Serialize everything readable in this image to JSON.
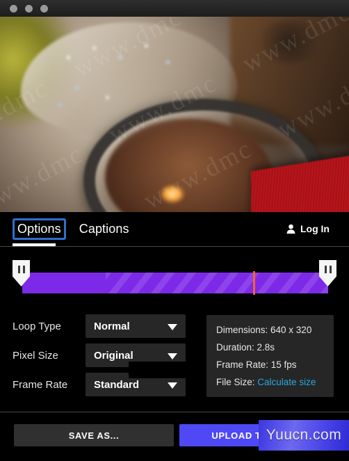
{
  "window": {
    "traffic_lights": [
      "close",
      "minimize",
      "zoom"
    ]
  },
  "preview": {
    "watermark_text": "www.dmc"
  },
  "tabs": {
    "items": [
      {
        "label": "Options",
        "active": true,
        "focused": true
      },
      {
        "label": "Captions",
        "active": false,
        "focused": false
      }
    ]
  },
  "account": {
    "login_label": "Log In",
    "icon": "user-icon"
  },
  "timeline": {
    "left_handle_icon": "pause-bars-icon",
    "right_handle_icon": "pause-bars-icon",
    "track_color": "#7d2ae8",
    "playhead_color": "#f0652f",
    "trim_start_percent": 0,
    "trim_end_percent": 100,
    "playhead_percent": 75
  },
  "options": {
    "rows": [
      {
        "label": "Loop Type",
        "value": "Normal",
        "chevron": "chevron-down-icon"
      },
      {
        "label": "Pixel Size",
        "value": "Original",
        "chevron": "chevron-down-icon"
      },
      {
        "label": "Frame Rate",
        "value": "Standard",
        "chevron": "chevron-down-icon"
      }
    ]
  },
  "info": {
    "dimensions_label": "Dimensions: 640 x 320",
    "duration_label": "Duration: 2.8s",
    "frame_rate_label": "Frame Rate: 15 fps",
    "file_size_label": "File Size:",
    "file_size_link": "Calculate size",
    "link_color": "#29a8dd"
  },
  "footer": {
    "save_label": "SAVE AS...",
    "upload_label": "UPLOAD TO IMGUR",
    "upload_color": "#4e49f5"
  },
  "overlay": {
    "watermark": "Yuucn.com"
  }
}
